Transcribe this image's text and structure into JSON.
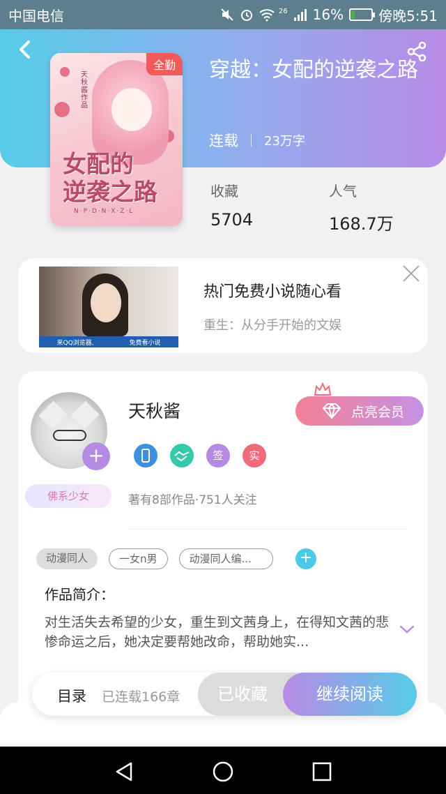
{
  "status_bar": {
    "carrier": "中国电信",
    "network": "26",
    "battery": "16%",
    "battery_level": 0.16,
    "time": "傍晚5:51"
  },
  "book": {
    "cover_badge": "全勤",
    "cover_title_line1": "女配的",
    "cover_title_line2": "逆袭之路",
    "cover_author": "天秋酱作品",
    "cover_pinyin": "N·P·D·N·X·Z·L",
    "title": "穿越：女配的逆袭之路",
    "status": "连载",
    "word_count": "23万字",
    "stats": [
      {
        "label": "收藏",
        "value": "5704"
      },
      {
        "label": "人气",
        "value": "168.7万"
      }
    ]
  },
  "ad": {
    "title": "热门免费小说随心看",
    "subtitle": "重生：从分手开始的文娱",
    "image_caption_left": "来QQ浏览器,",
    "image_caption_right": "免费看小说"
  },
  "author": {
    "name": "天秋酱",
    "persona_tag": "佛系少女",
    "vip_button": "点亮会员",
    "badges": [
      {
        "icon": "phone-badge-icon",
        "text": "",
        "color": "#3d8fe0"
      },
      {
        "icon": "handshake-badge-icon",
        "text": "",
        "color": "#35c9a9"
      },
      {
        "icon": "sign-badge-icon",
        "text": "签",
        "color": "#b38be2"
      },
      {
        "icon": "real-badge-icon",
        "text": "实",
        "color": "#f06a7a"
      }
    ],
    "stats": "著有8部作品·751人关注"
  },
  "tags": {
    "items": [
      "动漫同人",
      "一女n男",
      "动漫同人编..."
    ],
    "add_label": "+"
  },
  "intro": {
    "label": "作品简介：",
    "text": "对生活失去希望的少女，重生到文茜身上，在得知文茜的悲惨命运之后，她决定要帮她改命，帮助她实..."
  },
  "action_bar": {
    "toc_label": "目录",
    "chapters": "已连载166章",
    "collected_label": "已收藏",
    "continue_label": "继续阅读"
  },
  "colors": {
    "header_start": "#56cde8",
    "header_end": "#b78be7",
    "accent_purple": "#b38be2",
    "accent_cyan": "#4cc9e8",
    "badge_red": "#f05a5a"
  }
}
